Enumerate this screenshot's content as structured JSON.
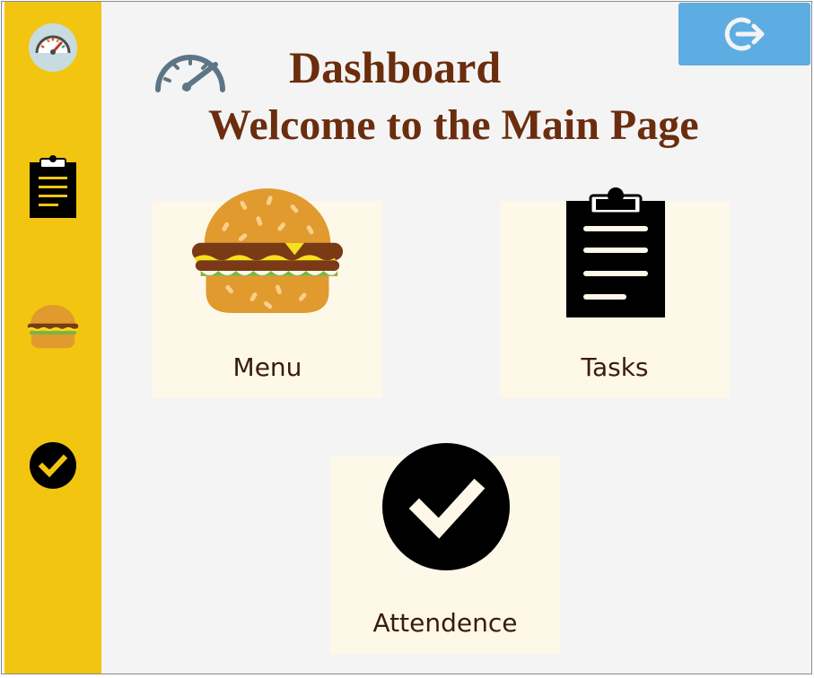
{
  "header": {
    "title": "Dashboard",
    "subtitle": "Welcome to the Main Page"
  },
  "sidebar": {
    "items": [
      {
        "icon": "dashboard-gauge-icon"
      },
      {
        "icon": "clipboard-icon"
      },
      {
        "icon": "burger-icon"
      },
      {
        "icon": "checkmark-circle-icon"
      }
    ]
  },
  "logout": {
    "icon": "logout-icon"
  },
  "cards": [
    {
      "label": "Menu",
      "icon": "burger-icon"
    },
    {
      "label": "Tasks",
      "icon": "clipboard-icon"
    },
    {
      "label": "Attendence",
      "icon": "checkmark-circle-icon"
    }
  ],
  "colors": {
    "sidebar": "#f2c511",
    "content_bg": "#f4f4f4",
    "card_bg": "#fdf8e8",
    "title": "#6b2d0e",
    "logout_button": "#5dade2"
  }
}
